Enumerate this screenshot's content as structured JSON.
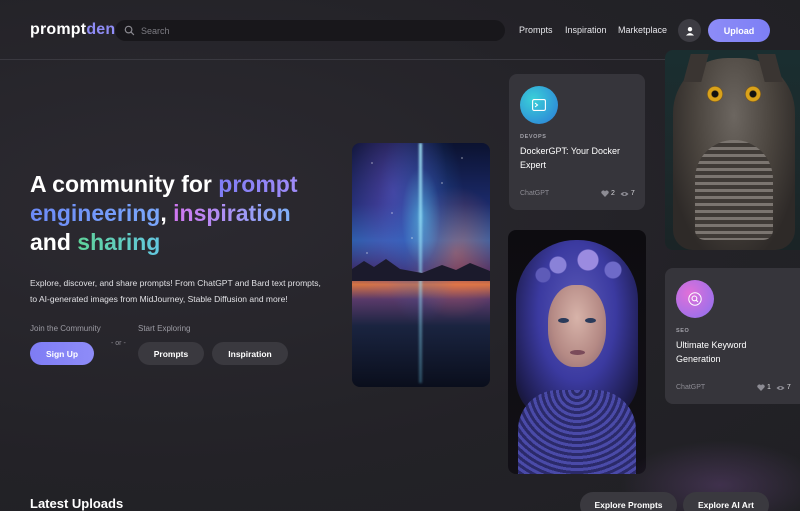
{
  "brand": {
    "part1": "prompt",
    "part2": "den",
    "accent": "#8f8cf6"
  },
  "search": {
    "placeholder": "Search"
  },
  "nav": {
    "prompts": "Prompts",
    "inspiration": "Inspiration",
    "marketplace": "Marketplace"
  },
  "header": {
    "upload_label": "Upload",
    "avatar_icon": "user-icon"
  },
  "hero": {
    "title_1": "A community for ",
    "title_2": "prompt",
    "title_3": "engineering",
    "title_4": ", ",
    "title_5": "inspiration",
    "title_6": "and ",
    "title_7": "sharing",
    "description": "Explore, discover, and share prompts! From ChatGPT and Bard text prompts, to AI-generated images from MidJourney, Stable Diffusion and more!",
    "join_label": "Join the Community",
    "explore_label": "Start Exploring",
    "or_label": "- or -",
    "signup_button": "Sign Up",
    "prompts_button": "Prompts",
    "inspiration_button": "Inspiration"
  },
  "cards": [
    {
      "category": "DEVOPS",
      "title": "DockerGPT: Your Docker Expert",
      "model": "ChatGPT",
      "likes": "2",
      "views": "7",
      "icon": "terminal-icon"
    },
    {
      "category": "SEO",
      "title": "Ultimate Keyword Generation",
      "model": "ChatGPT",
      "likes": "1",
      "views": "7",
      "icon": "search-icon"
    }
  ],
  "latest": {
    "heading": "Latest Uploads",
    "explore_prompts": "Explore Prompts",
    "explore_ai_art": "Explore AI Art"
  }
}
